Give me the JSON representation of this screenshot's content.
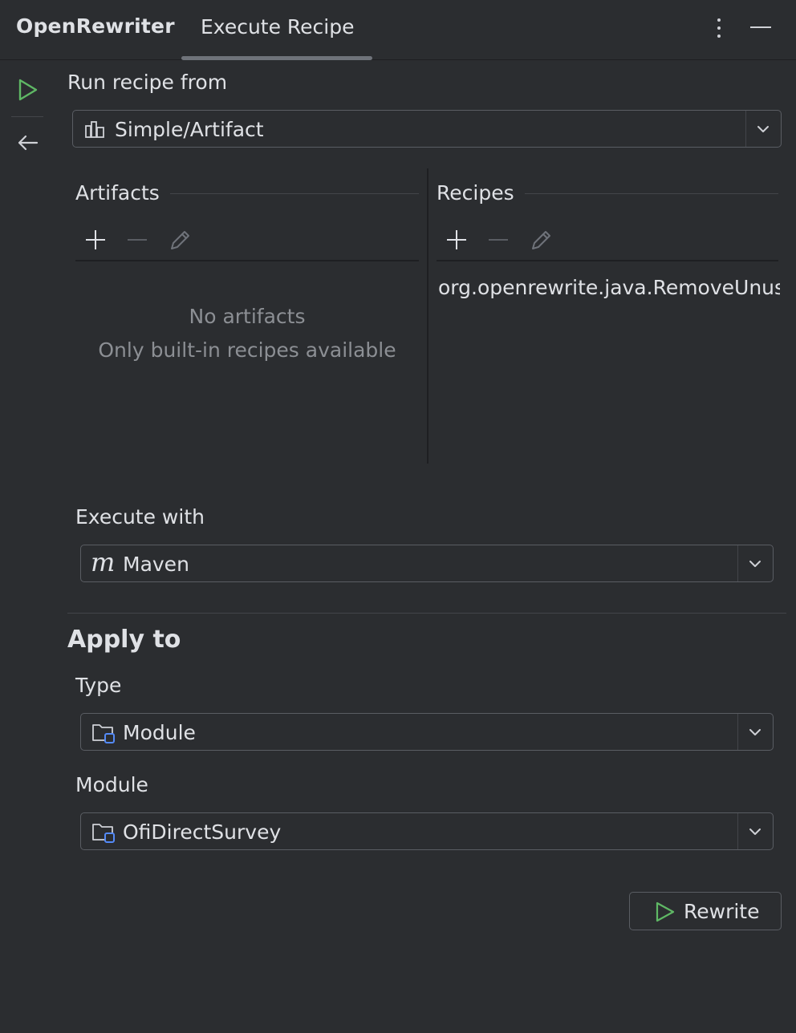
{
  "header": {
    "app_title": "OpenRewriter",
    "active_tab": "Execute Recipe",
    "icons": [
      "more-vertical-icon",
      "minimize-icon"
    ]
  },
  "toolbar": {
    "icons": [
      "run-icon",
      "back-arrow-icon"
    ],
    "run_color": "#5fb865"
  },
  "run_from": {
    "label": "Run recipe from",
    "value": "Simple/Artifact",
    "icon": "library-icon"
  },
  "artifacts": {
    "title": "Artifacts",
    "actions": [
      "add-icon",
      "remove-icon",
      "edit-icon"
    ],
    "empty_primary": "No artifacts",
    "empty_secondary": "Only built-in recipes available"
  },
  "recipes": {
    "title": "Recipes",
    "actions": [
      "add-icon",
      "remove-icon",
      "edit-icon"
    ],
    "items": [
      "org.openrewrite.java.RemoveUnus"
    ]
  },
  "execute_with": {
    "label": "Execute with",
    "value": "Maven",
    "icon": "maven-icon"
  },
  "apply_to": {
    "title": "Apply to",
    "type_label": "Type",
    "type_value": "Module",
    "module_label": "Module",
    "module_value": "OfiDirectSurvey",
    "icon": "module-folder-icon"
  },
  "actions": {
    "rewrite_label": "Rewrite"
  },
  "colors": {
    "background": "#2b2d30",
    "text": "#dfe1e5",
    "muted_text": "#8c8f94",
    "accent_green": "#5fb865",
    "module_blue": "#548af7"
  }
}
